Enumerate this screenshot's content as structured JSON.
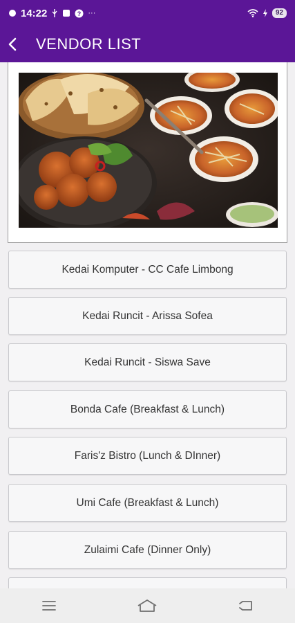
{
  "status_bar": {
    "time": "14:22",
    "dots": "···",
    "battery": "92"
  },
  "app_bar": {
    "title": "VENDOR LIST"
  },
  "vendors": [
    "Kedai Komputer - CC Cafe Limbong",
    "Kedai Runcit - Arissa Sofea",
    "Kedai Runcit - Siswa Save",
    "Bonda Cafe (Breakfast & Lunch)",
    "Faris'z Bistro (Lunch & DInner)",
    "Umi Cafe (Breakfast & Lunch)",
    "Zulaimi Cafe (Dinner Only)"
  ],
  "icons": {
    "back": "arrow-left-icon",
    "menu": "menu-icon",
    "home": "home-icon",
    "back_nav": "back-icon"
  },
  "colors": {
    "primary": "#5b1697",
    "background": "#f1f0f2",
    "button_bg": "#f7f7f8"
  }
}
